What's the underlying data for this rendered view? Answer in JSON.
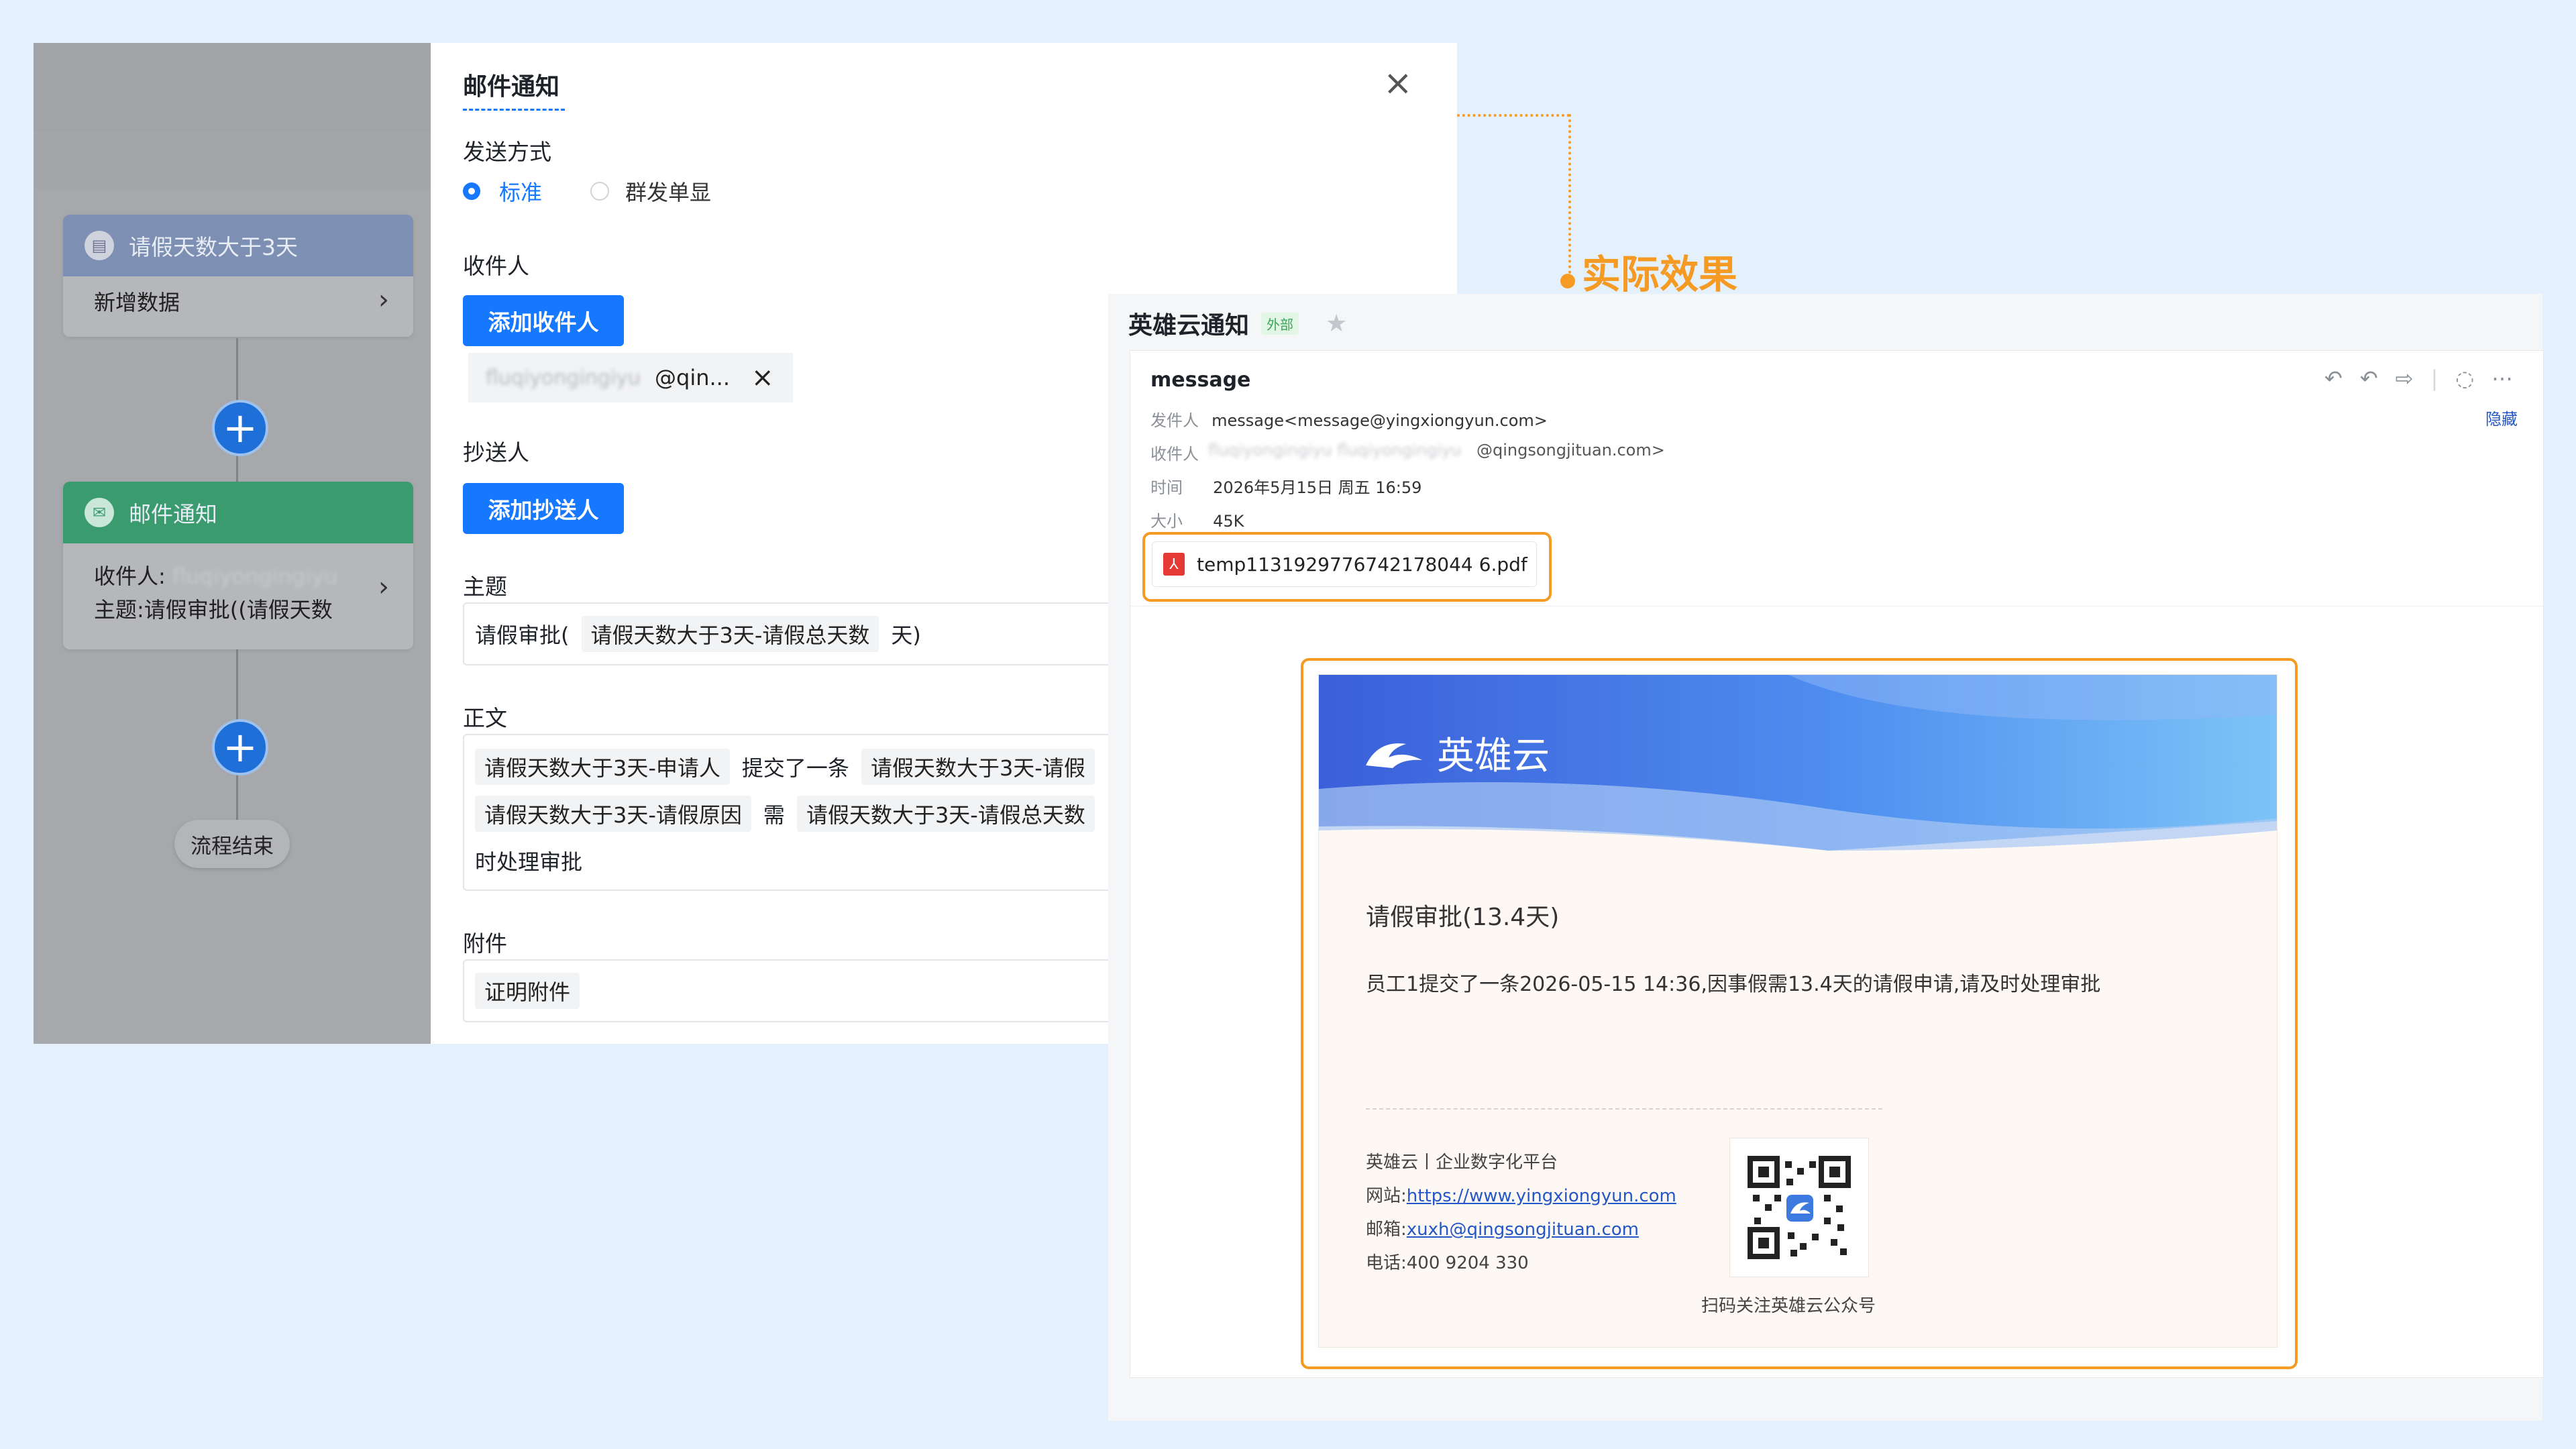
{
  "flow": {
    "node1_title": "请假天数大于3天",
    "node1_body": "新增数据",
    "node2_title": "邮件通知",
    "node2_recipient_label": "收件人:",
    "node2_recipient_value": "fluqiyongingiyu",
    "node2_subject": "主题:请假审批((请假天数",
    "end_label": "流程结束"
  },
  "panel": {
    "title": "邮件通知",
    "send_mode_label": "发送方式",
    "radio_standard": "标准",
    "radio_group": "群发单显",
    "recipient_label": "收件人",
    "add_recipient_button": "添加收件人",
    "recipient_blurred": "fluqiyongingiyu",
    "recipient_domain": "@qin...",
    "cc_label": "抄送人",
    "add_cc_button": "添加抄送人",
    "subject_label": "主题",
    "subject_prefix": "请假审批(",
    "subject_token": "请假天数大于3天-请假总天数",
    "subject_suffix": "天)",
    "body_label": "正文",
    "body_token1": "请假天数大于3天-申请人",
    "body_text1": "提交了一条",
    "body_token2": "请假天数大于3天-请假",
    "body_token3": "请假天数大于3天-请假原因",
    "body_text2": "需",
    "body_token4": "请假天数大于3天-请假总天数",
    "body_text3": "时处理审批",
    "attachment_label": "附件",
    "attachment_token": "证明附件"
  },
  "callout": {
    "label": "实际效果"
  },
  "mail": {
    "header_title": "英雄云通知",
    "external_badge": "外部",
    "subject": "message",
    "sender_label": "发件人",
    "sender_value": "message<message@yingxiongyun.com>",
    "to_label": "收件人",
    "to_blurred": "fluqiyongingiyu  fluqiyongingiyu",
    "to_domain": "@qingsongjituan.com>",
    "time_label": "时间",
    "time_value": "2026年5月15日 周五 16:59",
    "size_label": "大小",
    "size_value": "45K",
    "hide_link": "隐藏",
    "attachment_name": "temp1131929776742178044 6.pdf",
    "banner_brand": "英雄云",
    "content_title": "请假审批(13.4天)",
    "content_body": "员工1提交了一条2026-05-15 14:36,因事假需13.4天的请假申请,请及时处理审批",
    "footer_company": "英雄云丨企业数字化平台",
    "footer_site_label": "网站:",
    "footer_site": "https://www.yingxiongyun.com",
    "footer_email_label": "邮箱:",
    "footer_email": "xuxh@qingsongjituan.com",
    "footer_phone": "电话:400 9204 330",
    "qr_caption": "扫码关注英雄云公众号"
  },
  "colors": {
    "primary": "#1677ff",
    "accent_orange": "#f59a23",
    "node_green": "#2aa36b",
    "node_blue": "#4a6fb8"
  }
}
